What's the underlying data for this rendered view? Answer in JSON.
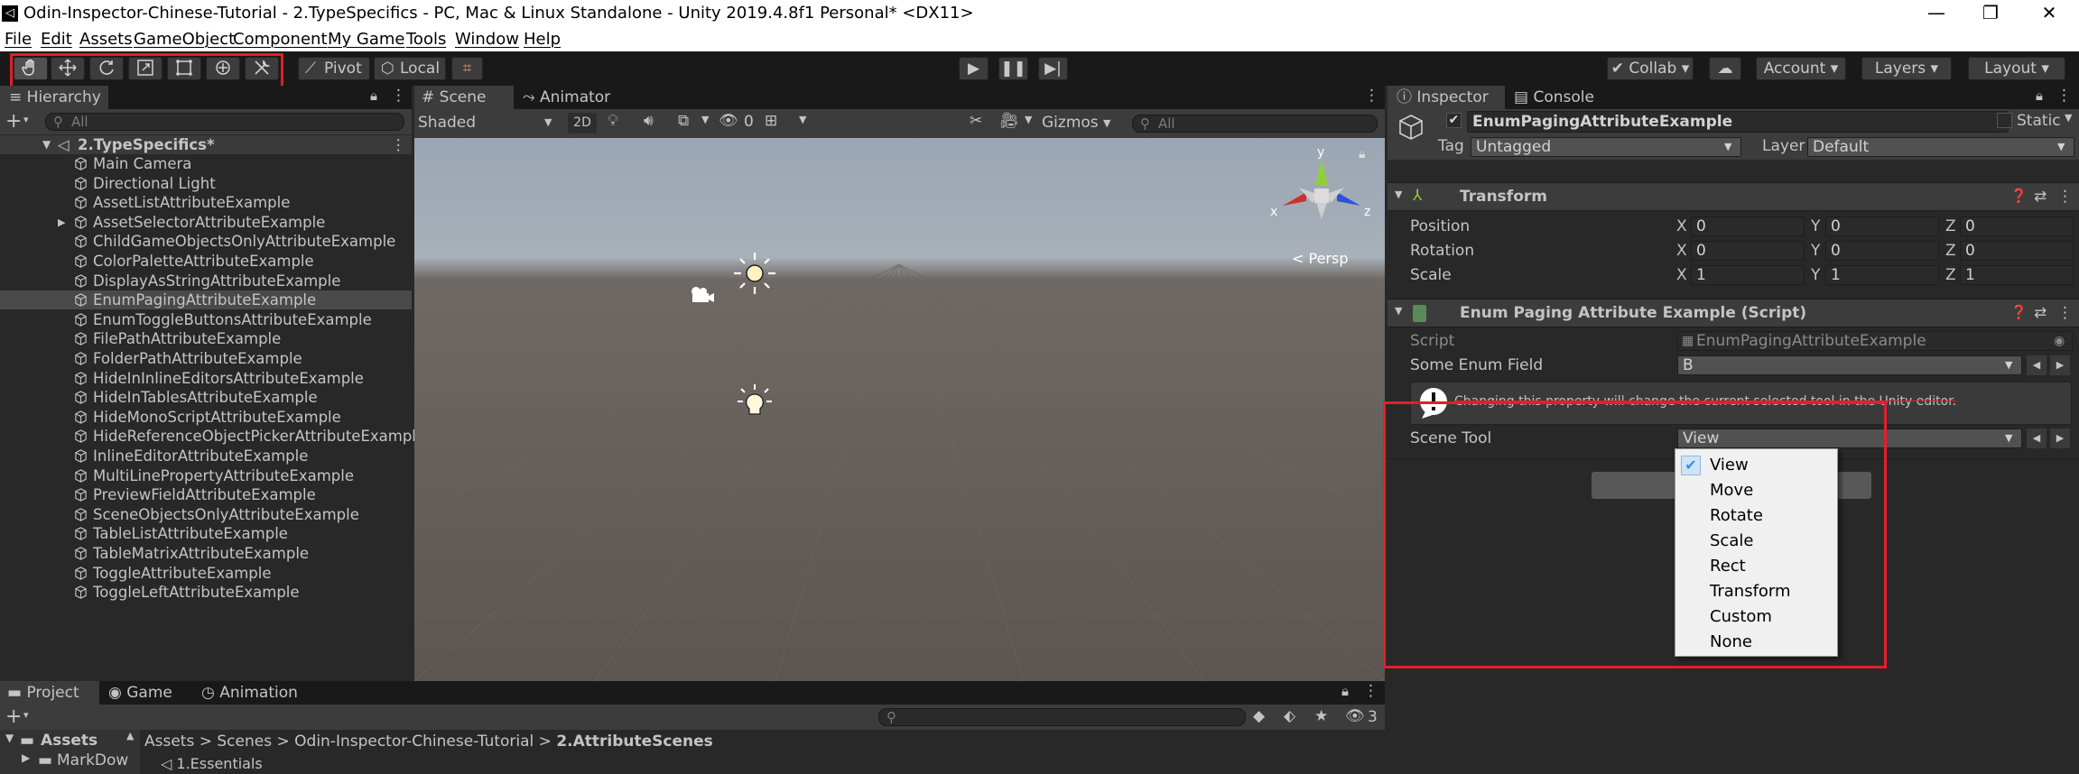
{
  "window": {
    "title": "Odin-Inspector-Chinese-Tutorial - 2.TypeSpecifics - PC, Mac & Linux Standalone - Unity 2019.4.8f1 Personal* <DX11>",
    "app_icon": "unity-icon",
    "minimize": "—",
    "restore": "❐",
    "close": "✕"
  },
  "menu": [
    "File",
    "Edit",
    "Assets",
    "GameObject",
    "Component",
    "My Game",
    "Tools",
    "Window",
    "Help"
  ],
  "toolbar": {
    "pivot": "Pivot",
    "local": "Local",
    "collab": "Collab",
    "account": "Account",
    "layers": "Layers",
    "layout": "Layout"
  },
  "hierarchy": {
    "tab": "Hierarchy",
    "search_placeholder": "All",
    "scene_name": "2.TypeSpecifics*",
    "items": [
      "Main Camera",
      "Directional Light",
      "AssetListAttributeExample",
      "AssetSelectorAttributeExample",
      "ChildGameObjectsOnlyAttributeExample",
      "ColorPaletteAttributeExample",
      "DisplayAsStringAttributeExample",
      "EnumPagingAttributeExample",
      "EnumToggleButtonsAttributeExample",
      "FilePathAttributeExample",
      "FolderPathAttributeExample",
      "HideInInlineEditorsAttributeExample",
      "HideInTablesAttributeExample",
      "HideMonoScriptAttributeExample",
      "HideReferenceObjectPickerAttributeExample",
      "InlineEditorAttributeExample",
      "MultiLinePropertyAttributeExample",
      "PreviewFieldAttributeExample",
      "SceneObjectsOnlyAttributeExample",
      "TableListAttributeExample",
      "TableMatrixAttributeExample",
      "ToggleAttributeExample",
      "ToggleLeftAttributeExample"
    ],
    "selected_index": 7,
    "expandable_index": 3
  },
  "scene": {
    "tabs": [
      "Scene",
      "Animator"
    ],
    "shading": "Shaded",
    "mode_2d": "2D",
    "fx_count": "0",
    "gizmos": "Gizmos",
    "search_placeholder": "All",
    "persp": "Persp",
    "axis_x": "x",
    "axis_y": "y",
    "axis_z": "z"
  },
  "inspector": {
    "tabs": [
      "Inspector",
      "Console"
    ],
    "object_name": "EnumPagingAttributeExample",
    "static_label": "Static",
    "tag_label": "Tag",
    "tag_value": "Untagged",
    "layer_label": "Layer",
    "layer_value": "Default",
    "transform": {
      "title": "Transform",
      "rows": [
        {
          "label": "Position",
          "x": "0",
          "y": "0",
          "z": "0"
        },
        {
          "label": "Rotation",
          "x": "0",
          "y": "0",
          "z": "0"
        },
        {
          "label": "Scale",
          "x": "1",
          "y": "1",
          "z": "1"
        }
      ]
    },
    "script_component": {
      "title": "Enum Paging Attribute Example (Script)",
      "script_label": "Script",
      "script_value": "EnumPagingAttributeExample",
      "enum_field_label": "Some Enum Field",
      "enum_field_value": "B",
      "info_message": "Changing this property will change the current selected tool in the Unity editor.",
      "scene_tool_label": "Scene Tool",
      "scene_tool_value": "View"
    }
  },
  "scene_tool_dropdown": {
    "options": [
      "View",
      "Move",
      "Rotate",
      "Scale",
      "Rect",
      "Transform",
      "Custom",
      "None"
    ],
    "checked": "View"
  },
  "project": {
    "tabs": [
      "Project",
      "Game",
      "Animation"
    ],
    "assets_label": "Assets",
    "folder": "MarkDow",
    "breadcrumb": [
      "Assets",
      "Scenes",
      "Odin-Inspector-Chinese-Tutorial",
      "2.AttributeScenes"
    ],
    "first_item": "1.Essentials",
    "hidden_count": "3"
  },
  "colors": {
    "highlight_red": "#e0202a",
    "selection": "#4a4a4a",
    "panel_bg": "#282828",
    "check_blue": "#3a8ee6"
  }
}
